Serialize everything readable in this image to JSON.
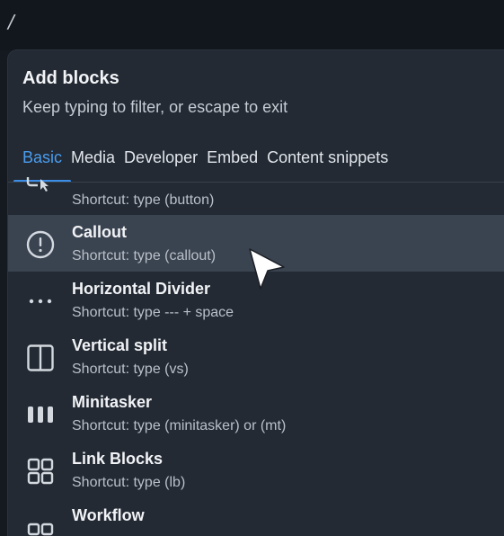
{
  "editor": {
    "typed_text": "/"
  },
  "popup": {
    "title": "Add blocks",
    "subtitle": "Keep typing to filter, or escape to exit",
    "tabs": [
      {
        "label": "Basic",
        "active": true
      },
      {
        "label": "Media"
      },
      {
        "label": "Developer"
      },
      {
        "label": "Embed"
      },
      {
        "label": "Content snippets"
      }
    ],
    "items": [
      {
        "name": "",
        "shortcut": "Shortcut: type (button)",
        "icon": "button-icon"
      },
      {
        "name": "Callout",
        "shortcut": "Shortcut: type (callout)",
        "icon": "exclamation-circle-icon",
        "selected": true
      },
      {
        "name": "Horizontal Divider",
        "shortcut": "Shortcut: type --- + space",
        "icon": "horizontal-dots-icon"
      },
      {
        "name": "Vertical split",
        "shortcut": "Shortcut: type (vs)",
        "icon": "vertical-split-icon"
      },
      {
        "name": "Minitasker",
        "shortcut": "Shortcut: type (minitasker) or (mt)",
        "icon": "minitasker-columns-icon"
      },
      {
        "name": "Link Blocks",
        "shortcut": "Shortcut: type (lb)",
        "icon": "grid-icon"
      },
      {
        "name": "Workflow",
        "shortcut": "",
        "icon": "workflow-icon"
      }
    ]
  },
  "colors": {
    "accent": "#3b8ee8",
    "popup_bg": "#232a33",
    "selected_bg": "#3a4350"
  }
}
